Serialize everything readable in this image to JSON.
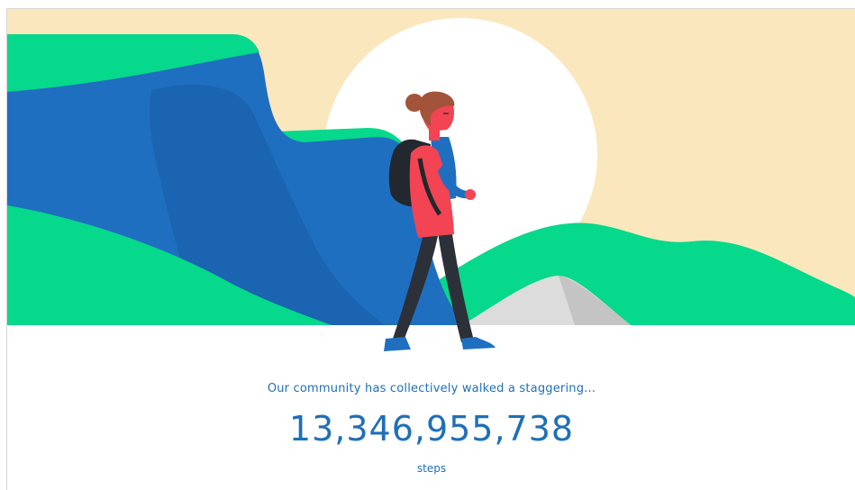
{
  "hero": {
    "illustration": "hiker-walking-mountain-illustration",
    "colors": {
      "sky": "#fbe7bd",
      "sun": "#ffffff",
      "cliff": "#1f6fc1",
      "hills": "#06d88c",
      "rock": "#dcdcdc",
      "jacket": "#f24452",
      "hair": "#a2533a",
      "backpack": "#23272e"
    }
  },
  "stats": {
    "caption": "Our community has collectively walked a staggering...",
    "count": "13,346,955,738",
    "unit": "steps"
  }
}
